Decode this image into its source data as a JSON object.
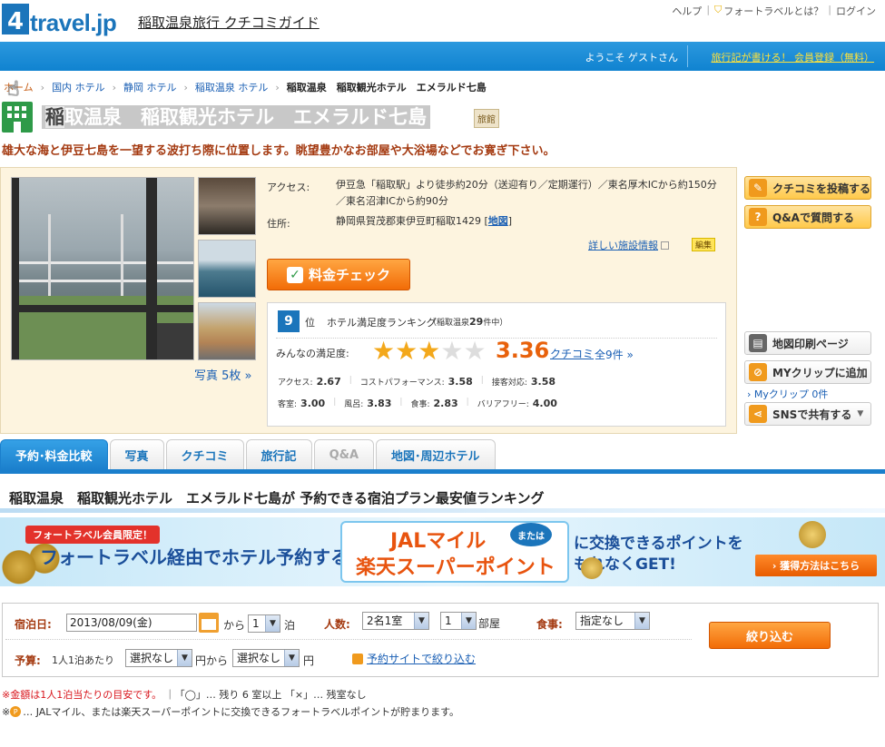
{
  "header": {
    "logo_digit": "4",
    "logo_text": "travel.jp",
    "site_title": "稲取温泉旅行 クチコミガイド",
    "top_links": [
      "ヘルプ",
      "フォートラベルとは？",
      "ログイン"
    ],
    "welcome": "ようこそ ゲストさん",
    "register": "旅行記が書ける！ 会員登録（無料）"
  },
  "breadcrumb": {
    "items": [
      "ホーム",
      "国内 ホテル",
      "静岡 ホテル",
      "稲取温泉 ホテル"
    ],
    "current": "稲取温泉　稲取観光ホテル　エメラルド七島"
  },
  "hotel": {
    "name_first": "稲",
    "name_rest": "取温泉　稲取観光ホテル　エメラルド七島",
    "type": "旅館",
    "catchcopy": "雄大な海と伊豆七島を一望する波打ち際に位置します。眺望豊かなお部屋や大浴場などでお寛ぎ下さい。",
    "photos_link": "写真 5枚 »",
    "access_label": "アクセス:",
    "access": "伊豆急「稲取駅」より徒歩約20分（送迎有り／定期運行）／東名厚木ICから約150分／東名沼津ICから約90分",
    "address_label": "住所:",
    "address": "静岡県賀茂郡東伊豆町稲取1429",
    "map_link": "地図",
    "detail_link": "詳しい施設情報",
    "edit": "編集",
    "price_check": "料金チェック"
  },
  "ranking": {
    "rank": "9",
    "unit": "位",
    "title": "ホテル満足度ランキング",
    "sub_pre": "（稲取温泉",
    "sub_count": "29",
    "sub_post": "件中）",
    "satisfaction_label": "みんなの満足度:",
    "rating": 3.36,
    "score": "3.36",
    "kuchikomi_link": "クチコミ",
    "count_link": "全9件 »",
    "star_color": "#f3a81b",
    "star_empty_color": "#dddddd",
    "row1": [
      {
        "label": "アクセス:",
        "value": "2.67"
      },
      {
        "label": "コストパフォーマンス:",
        "value": "3.58"
      },
      {
        "label": "接客対応:",
        "value": "3.58"
      }
    ],
    "row2": [
      {
        "label": "客室:",
        "value": "3.00"
      },
      {
        "label": "風呂:",
        "value": "3.83"
      },
      {
        "label": "食事:",
        "value": "2.83"
      },
      {
        "label": "バリアフリー:",
        "value": "4.00"
      }
    ]
  },
  "side": {
    "post_review": "クチコミを投稿する",
    "qa": "Q&Aで質問する",
    "map_print": "地図印刷ページ",
    "myclip": "MYクリップに追加",
    "myclip_link": "Myクリップ  0件",
    "sns": "SNSで共有する"
  },
  "tabs": [
    "予約･料金比較",
    "写真",
    "クチコミ",
    "旅行記",
    "Q&A",
    "地図･周辺ホテル"
  ],
  "section_title": "稲取温泉　稲取観光ホテル　エメラルド七島が 予約できる宿泊プラン最安値ランキング",
  "banner": {
    "tag": "フォートラベル会員限定！",
    "main": "フォートラベル経由でホテル予約すると、",
    "jal": "JALマイル",
    "or": "または",
    "rakuten": "楽天スーパーポイント",
    "right_line1": "に交換できるポイントを",
    "right_line2": "もれなくGET!",
    "button": "› 獲得方法はこちら"
  },
  "search": {
    "date_label": "宿泊日:",
    "date_value": "2013/08/09(金)",
    "from": "から",
    "nights_value": "1",
    "nights_unit": "泊",
    "people_label": "人数:",
    "people_value": "2名1室",
    "rooms_value": "1",
    "rooms_unit": "部屋",
    "meal_label": "食事:",
    "meal_value": "指定なし",
    "budget_label": "予算:",
    "budget_per": "1人1泊あたり",
    "budget_min": "選択なし",
    "budget_from": "円から",
    "budget_max": "選択なし",
    "budget_yen": "円",
    "narrow_button": "絞り込む",
    "site_narrow": "予約サイトで絞り込む"
  },
  "notes": {
    "note1_red": "※金額は1人1泊当たりの目安です。",
    "note1_rest": "｜「◯」… 残り 6 室以上 「×」… 残室なし",
    "note2_pre": "※",
    "note2_icon": "P",
    "note2": "… JALマイル、または楽天スーパーポイントに交換できるフォートラベルポイントが貯まります。"
  }
}
